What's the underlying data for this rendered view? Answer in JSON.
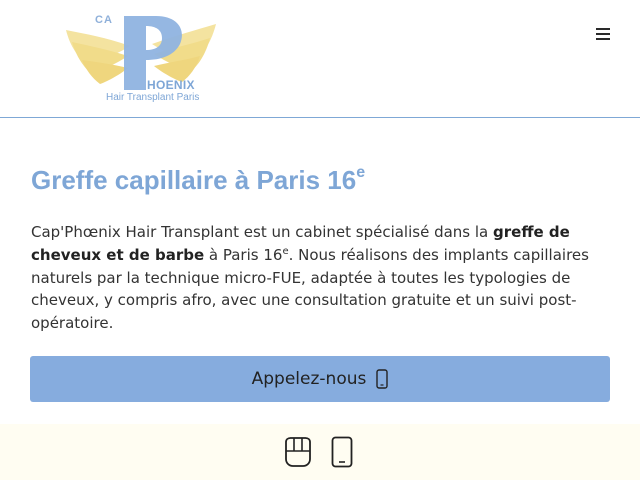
{
  "header": {
    "logo": {
      "ca": "CA",
      "name": "HOENIX",
      "tagline": "Hair Transplant Paris"
    },
    "menu_icon": "hamburger-menu-icon"
  },
  "main": {
    "title": "Greffe capillaire à Paris 16",
    "title_sup": "e",
    "intro_1": "Cap'Phœnix Hair Transplant est un cabinet spécialisé dans la ",
    "intro_bold": "greffe de cheveux et de barbe",
    "intro_2": " à Paris 16",
    "intro_sup": "e",
    "intro_3": ". Nous réalisons des implants capillaires naturels par la technique micro-FUE, adaptée à toutes les typologies de cheveux, y compris afro, avec une consultation gratuite et un suivi post-opératoire."
  },
  "cta": {
    "label": "Appelez-nous",
    "icon": "mobile-phone-icon"
  },
  "bottom_bar": {
    "icons": [
      "tooth-icon",
      "mobile-phone-icon"
    ]
  },
  "colors": {
    "brand_blue": "#7ea6d6",
    "cta_blue": "#86acde",
    "logo_gold": "#f1dc8a",
    "bottom_bar_bg": "#fffdf2"
  }
}
